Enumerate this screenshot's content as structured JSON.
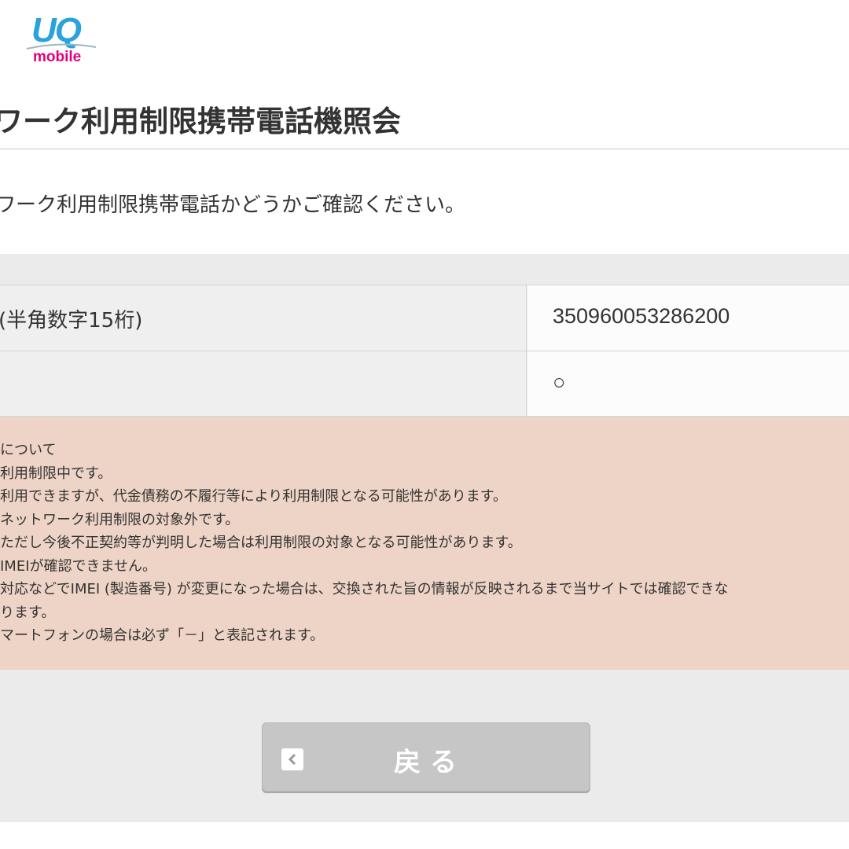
{
  "header": {
    "logo_top": "UQ",
    "logo_bottom": "mobile",
    "brand_colors": {
      "uq_blue": "#2aa3dc",
      "mobile_pink": "#e3007f"
    }
  },
  "page_title": "ワーク利用制限携帯電話機照会",
  "lead_text": "ワーク利用制限携帯電話かどうかご確認ください。",
  "result_table": [
    {
      "label": "(半角数字15桁)",
      "value": "350960053286200"
    },
    {
      "label": "",
      "value": "○"
    }
  ],
  "notes": [
    "について",
    "利用制限中です。",
    "利用できますが、代金債務の不履行等により利用制限となる可能性があります。",
    "ネットワーク利用制限の対象外です。",
    "ただし今後不正契約等が判明した場合は利用制限の対象となる可能性があります。",
    "IMEIが確認できません。",
    "対応などでIMEI (製造番号) が変更になった場合は、交換された旨の情報が反映されるまで当サイトでは確認できな",
    "ります。",
    "マートフォンの場合は必ず「－」と表記されます。"
  ],
  "back_button": {
    "label": "戻る",
    "icon": "chevron-left-icon"
  },
  "colors": {
    "notes_bg": "#eed4c6",
    "panel_bg": "#ebebeb",
    "button_bg": "#c6c6c6"
  }
}
